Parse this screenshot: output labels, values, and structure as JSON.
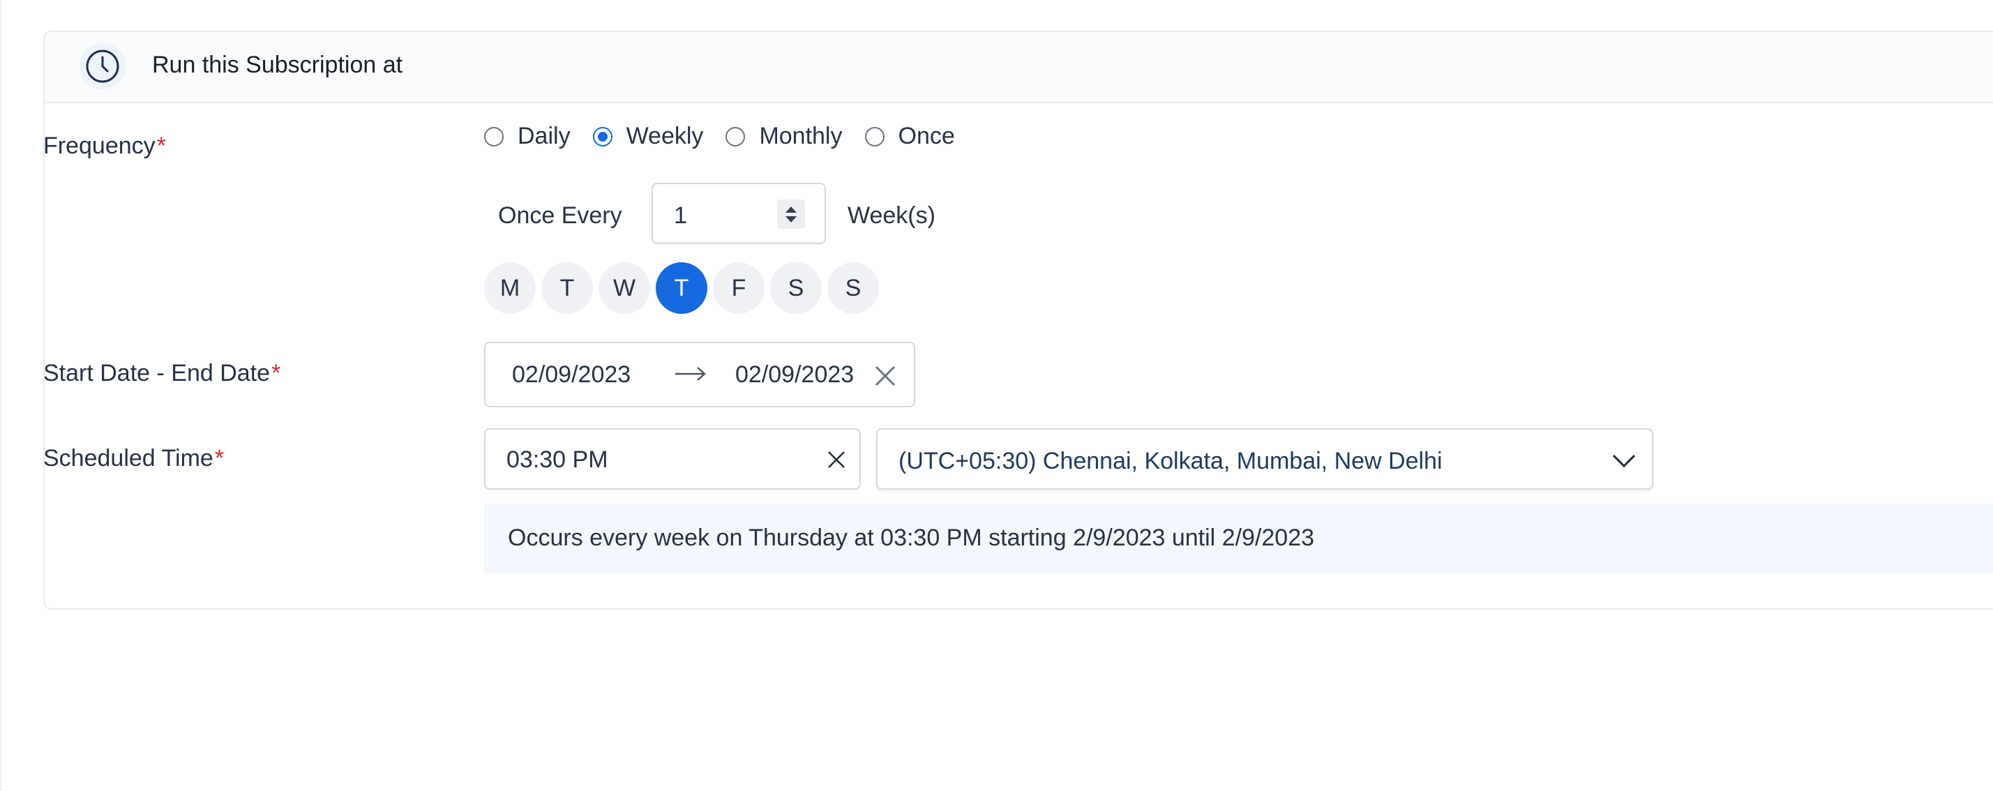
{
  "header": {
    "title": "Run this Subscription at",
    "icon": "clock-icon"
  },
  "frequency": {
    "label": "Frequency",
    "required_mark": "*",
    "options": [
      {
        "label": "Daily",
        "checked": false
      },
      {
        "label": "Weekly",
        "checked": true
      },
      {
        "label": "Monthly",
        "checked": false
      },
      {
        "label": "Once",
        "checked": false
      }
    ]
  },
  "interval": {
    "prefix": "Once Every",
    "value": "1",
    "suffix": "Week(s)"
  },
  "weekdays": [
    {
      "label": "M",
      "selected": false
    },
    {
      "label": "T",
      "selected": false
    },
    {
      "label": "W",
      "selected": false
    },
    {
      "label": "T",
      "selected": true
    },
    {
      "label": "F",
      "selected": false
    },
    {
      "label": "S",
      "selected": false
    },
    {
      "label": "S",
      "selected": false
    }
  ],
  "date_range": {
    "label": "Start Date - End Date",
    "required_mark": "*",
    "start": "02/09/2023",
    "end": "02/09/2023"
  },
  "scheduled_time": {
    "label": "Scheduled Time",
    "required_mark": "*",
    "time": "03:30 PM",
    "timezone": "(UTC+05:30) Chennai, Kolkata, Mumbai, New Delhi"
  },
  "summary": "Occurs every week on Thursday at 03:30 PM starting 2/9/2023 until 2/9/2023",
  "colors": {
    "accent": "#1769e0",
    "required": "#d42a2a",
    "summary_bg": "#f4f7fd"
  }
}
